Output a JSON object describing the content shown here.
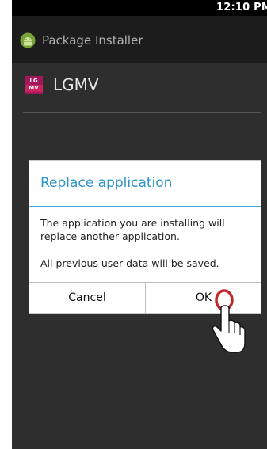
{
  "status_bar": {
    "time": "12:10 PM"
  },
  "app_bar": {
    "title": "Package Installer",
    "icon": "android-installer-icon"
  },
  "package": {
    "icon_text_top": "LG",
    "icon_text_bottom": "MV",
    "name": "LGMV"
  },
  "dialog": {
    "title": "Replace application",
    "message_1": "The application you are installing will replace another application.",
    "message_2": "All previous user data will be saved.",
    "cancel_label": "Cancel",
    "ok_label": "OK"
  },
  "colors": {
    "accent": "#2d95c9",
    "highlight_ring": "#c0282d"
  }
}
